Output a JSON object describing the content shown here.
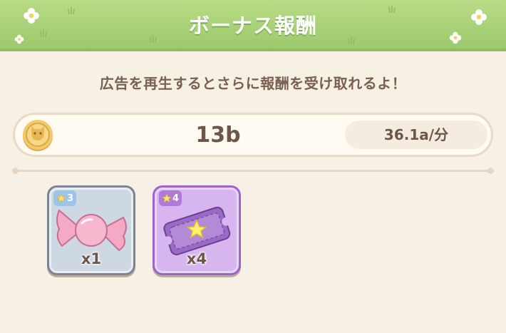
{
  "header": {
    "title": "ボーナス報酬"
  },
  "subtitle": "広告を再生するとさらに報酬を受け取れるよ！",
  "currency": {
    "icon": "cat-coin-icon",
    "amount": "13b",
    "rate": "36.1a/分"
  },
  "rewards": [
    {
      "item": "candy-icon",
      "rarity": "3",
      "count": "x1",
      "color": "#cdd8e2"
    },
    {
      "item": "ticket-icon",
      "rarity": "4",
      "count": "x4",
      "color": "#d7b6f0"
    }
  ],
  "colors": {
    "header_green": "#a6d075",
    "background": "#f7f0e4",
    "text_brown": "#6f564a"
  }
}
